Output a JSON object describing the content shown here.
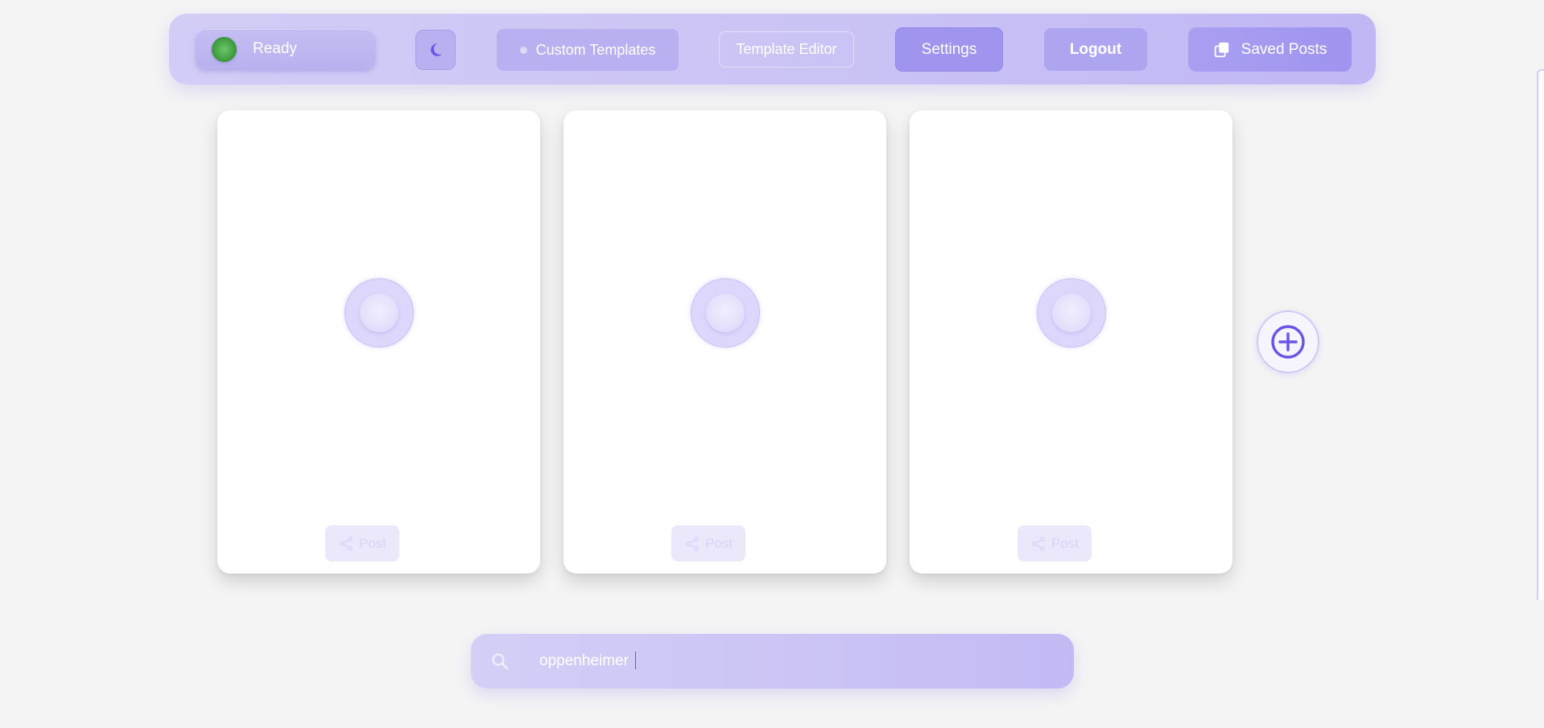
{
  "topbar": {
    "status_label": "Ready",
    "theme_icon": "moon-icon",
    "custom_templates_label": "Custom Templates",
    "template_editor_label": "Template Editor",
    "settings_label": "Settings",
    "logout_label": "Logout",
    "saved_posts_label": "Saved Posts",
    "saved_posts_icon": "collection-icon"
  },
  "cards": [
    {
      "post_label": "Post",
      "post_icon": "share-icon"
    },
    {
      "post_label": "Post",
      "post_icon": "share-icon"
    },
    {
      "post_label": "Post",
      "post_icon": "share-icon"
    }
  ],
  "add_card_icon": "plus-circle-icon",
  "search": {
    "value": "oppenheimer",
    "icon": "search-icon"
  },
  "colors": {
    "accent": "#9f95ee",
    "status_green": "#4aa84a",
    "icon_purple": "#6a55e6",
    "background": "#f4f4f5"
  }
}
